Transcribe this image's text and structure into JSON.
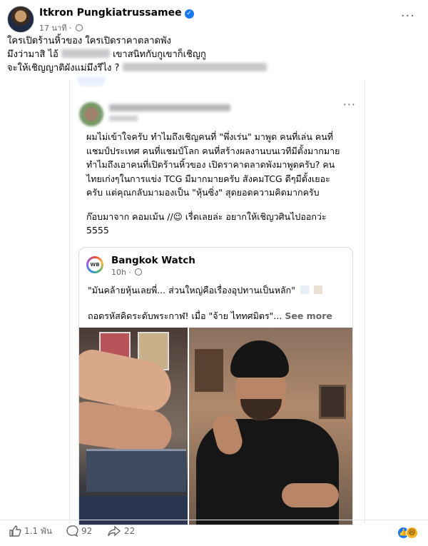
{
  "post": {
    "author": "Itkron Pungkiatrussamee",
    "time": "17 นาที",
    "caption_line1": "ใครเปิดร้านหิ้วของ ใครเปิดราคาตลาดพัง",
    "caption_line2_start": "มึงว่ามาสิ ไอ้",
    "caption_line2_end": "เขาสนิทกับกูเขาก็เชิญกู",
    "caption_line3_start": "จะให้เชิญญาติผังแม่มึงรึไง ?"
  },
  "shared_post": {
    "body": [
      "ผมไม่เข้าใจครับ ทำไมถึงเชิญคนที่ \"พึ่งเร่น\" มาพูด คนที่เล่น คนที่",
      "แชมป์ประเทศ คนที่แชมป์โลก คนที่สร้างผลงานบนเวทีมีตั้งมากมาย",
      "ทำไมถึงเอาคนที่เปิดร้านหิ้วของ เปิดราคาตลาดพังมาพูดครับ? คน",
      "ไทยเก่งๆในการแข่ง TCG มีมากมายครับ สังคมTCG ดีๆมีตั้งเยอะ",
      "ครับ แต่คุณกลับมามองเป็น \"หุ้นซิ่ง\" สุดยอดความคิดมากครับ"
    ],
    "body2_line1": "ก๊อบมาจาก คอมเม้น //😉  เรื่ดเลยล่ะ อยากให้เชิญวศินไปออกว่ะ",
    "body2_line2": "5555"
  },
  "link_card": {
    "logo_text": "WB",
    "page_name": "Bangkok Watch",
    "page_time": "10h ·",
    "line1": "\"มันคล้ายหุ้นเลยพี่... ส่วนใหญ่คือเรื่องอุปทานเป็นหลัก\"",
    "line2": "ถอดรหัสคิดระดับพระกาฬ! เมื่อ \"จ้าย ไททศมิตร\"...",
    "see_more": "See more"
  },
  "actions": {
    "likes": "1.1 พัน",
    "comments": "92",
    "shares": "22"
  },
  "colors": {
    "accent": "#1877f2",
    "secondary_text": "#65676b"
  }
}
